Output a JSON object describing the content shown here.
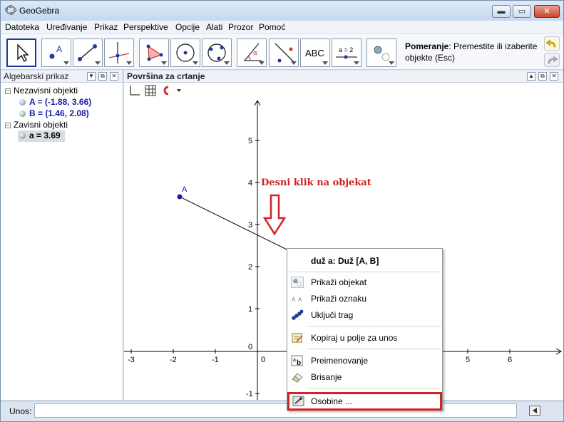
{
  "window": {
    "title": "GeoGebra",
    "minimize": "▬",
    "maximize": "▭",
    "close": "✕"
  },
  "menu": [
    "Datoteka",
    "Uređivanje",
    "Prikaz",
    "Perspektive",
    "Opcije",
    "Alati",
    "Prozor",
    "Pomoć"
  ],
  "toolbar": {
    "tooltip_bold": "Pomeranje",
    "tooltip_text": ": Premestite ili izaberite objekte (Esc)",
    "abc_label": "ABC",
    "slider_label": "a = 2",
    "point_label": "A"
  },
  "algebra": {
    "header": "Algebarski prikaz",
    "free_label": "Nezavisni objekti",
    "dependent_label": "Zavisni objekti",
    "items": [
      {
        "text": "A = (-1.88, 3.66)",
        "color": "#1a1aa6"
      },
      {
        "text": "B = (1.46, 2.08)",
        "color": "#1a1aa6"
      },
      {
        "text": "a = 3.69",
        "color": "#000000"
      }
    ]
  },
  "graphics": {
    "header": "Površina za crtanje",
    "annotation": "Desni klik na objekat",
    "annotation_color": "#cc2222",
    "point_label": "A",
    "x_ticks": [
      "-3",
      "-2",
      "-1",
      "0",
      "5",
      "6"
    ],
    "y_ticks": [
      "5",
      "4",
      "3",
      "2",
      "1",
      "-1"
    ],
    "origin_label": "0"
  },
  "context_menu": {
    "title": "duž a: Duž [A, B]",
    "items": [
      "Prikaži objekat",
      "Prikaži oznaku",
      "Uključi trag",
      "Kopiraj u polje za unos",
      "Preimenovanje",
      "Brisanje",
      "Osobine ..."
    ],
    "highlight_color": "#d0232a"
  },
  "input_bar": {
    "label": "Unos:",
    "value": ""
  }
}
